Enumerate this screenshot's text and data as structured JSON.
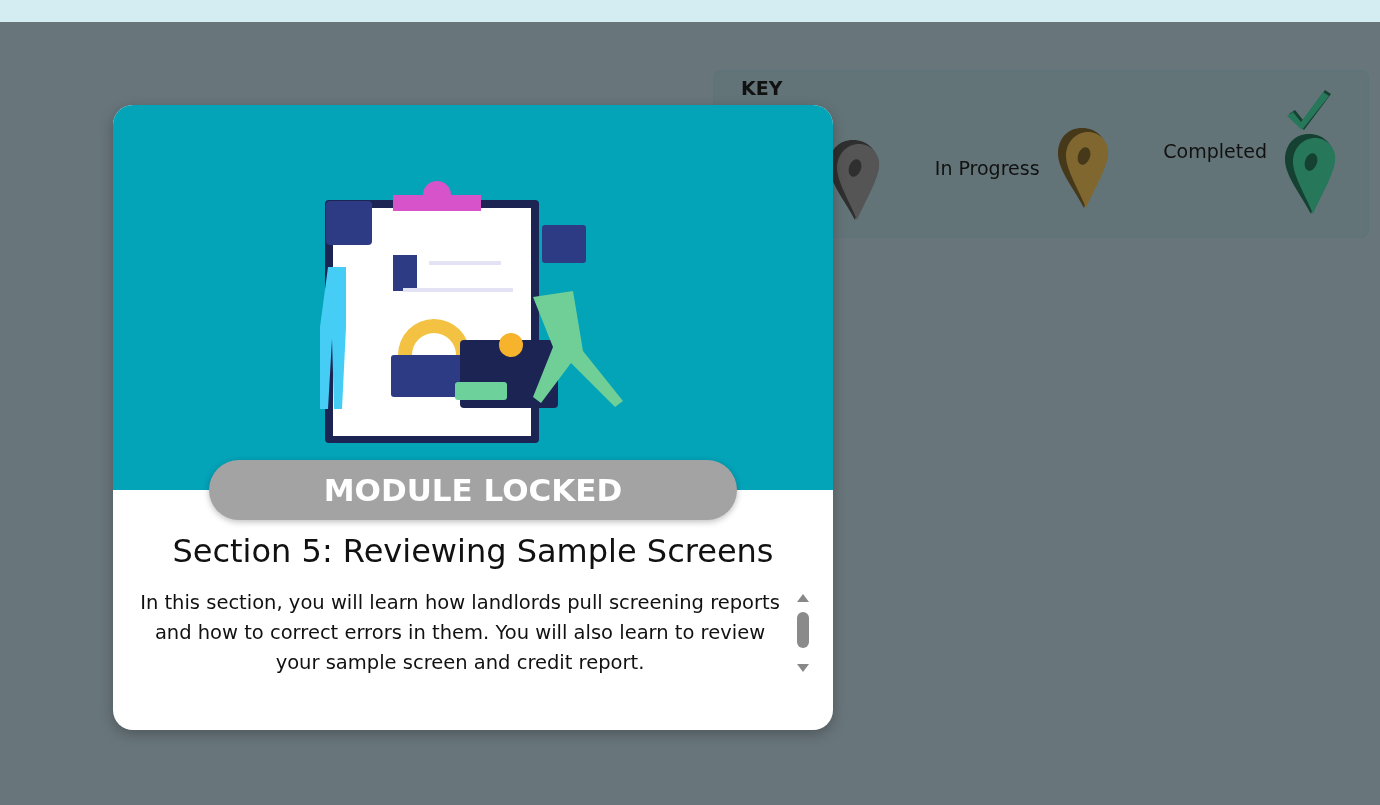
{
  "key": {
    "title": "KEY",
    "items": [
      {
        "kind": "not-started",
        "color": "#555555"
      },
      {
        "kind": "in-progress",
        "label": "In Progress",
        "color": "#80672f"
      },
      {
        "kind": "completed",
        "label": "Completed",
        "color": "#27775a"
      }
    ]
  },
  "module": {
    "status": "MODULE LOCKED",
    "title": "Section 5: Reviewing Sample Screens",
    "description": "In this section, you will learn how landlords pull screening reports and how to correct errors in them. You will also learn to review your sample screen and credit report."
  }
}
